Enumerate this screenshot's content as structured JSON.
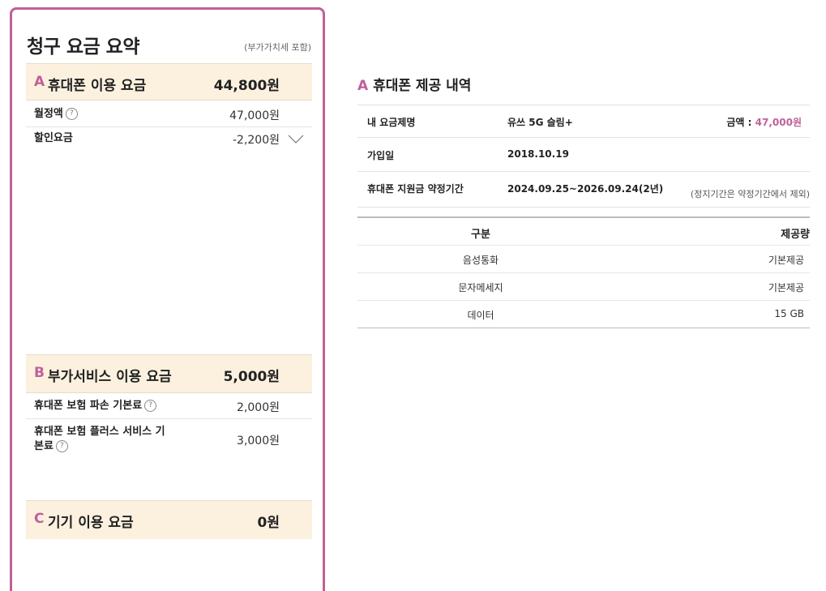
{
  "summary": {
    "title": "청구 요금 요약",
    "vat_note": "(부가가치세 포함)",
    "section_a": {
      "letter": "A",
      "name": "휴대폰 이용 요금",
      "amount": "44,800원",
      "rows": [
        {
          "label": "월정액",
          "value": "47,000원"
        },
        {
          "label": "할인요금",
          "value": "-2,200원"
        }
      ]
    },
    "section_b": {
      "letter": "B",
      "name": "부가서비스 이용 요금",
      "amount": "5,000원",
      "rows": [
        {
          "label": "휴대폰 보험 파손 기본료",
          "value": "2,000원"
        },
        {
          "label_line1": "휴대폰 보험 플러스 서비스 기",
          "label_line2": "본료",
          "value": "3,000원"
        }
      ]
    },
    "section_c": {
      "letter": "C",
      "name": "기기 이용 요금",
      "amount": "0원"
    },
    "help_glyph": "?"
  },
  "detail": {
    "letter": "A",
    "title": "휴대폰 제공 내역",
    "plan_label": "내 요금제명",
    "plan_name": "유쓰 5G 슬림+",
    "amount_label": "금액 : ",
    "amount_value": "47,000원",
    "join_label": "가입일",
    "join_date": "2018.10.19",
    "contract_label": "휴대폰 지원금 약정기간",
    "contract_period": "2024.09.25~2026.09.24(2년)",
    "contract_note": "(정지기간은 약정기간에서 제외)",
    "table": {
      "headers": [
        "구분",
        "제공량"
      ],
      "rows": [
        [
          "음성통화",
          "기본제공"
        ],
        [
          "문자메세지",
          "기본제공"
        ],
        [
          "데이터",
          "15 GB"
        ]
      ]
    }
  },
  "colors": {
    "accent": "#c0609a",
    "section_bg": "#fcf1df"
  }
}
